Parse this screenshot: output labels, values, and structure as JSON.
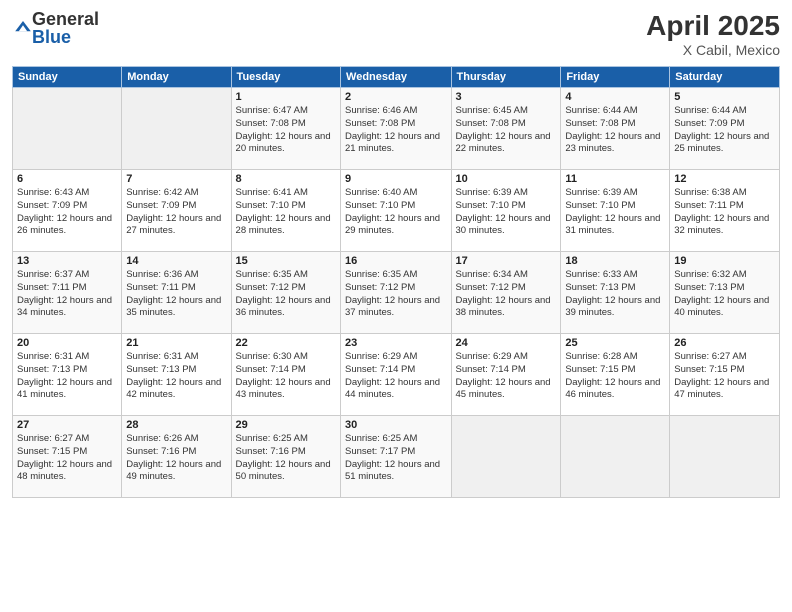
{
  "header": {
    "logo_general": "General",
    "logo_blue": "Blue",
    "title": "April 2025",
    "location": "X Cabil, Mexico"
  },
  "weekdays": [
    "Sunday",
    "Monday",
    "Tuesday",
    "Wednesday",
    "Thursday",
    "Friday",
    "Saturday"
  ],
  "weeks": [
    [
      {
        "day": "",
        "sunrise": "",
        "sunset": "",
        "daylight": ""
      },
      {
        "day": "",
        "sunrise": "",
        "sunset": "",
        "daylight": ""
      },
      {
        "day": "1",
        "sunrise": "Sunrise: 6:47 AM",
        "sunset": "Sunset: 7:08 PM",
        "daylight": "Daylight: 12 hours and 20 minutes."
      },
      {
        "day": "2",
        "sunrise": "Sunrise: 6:46 AM",
        "sunset": "Sunset: 7:08 PM",
        "daylight": "Daylight: 12 hours and 21 minutes."
      },
      {
        "day": "3",
        "sunrise": "Sunrise: 6:45 AM",
        "sunset": "Sunset: 7:08 PM",
        "daylight": "Daylight: 12 hours and 22 minutes."
      },
      {
        "day": "4",
        "sunrise": "Sunrise: 6:44 AM",
        "sunset": "Sunset: 7:08 PM",
        "daylight": "Daylight: 12 hours and 23 minutes."
      },
      {
        "day": "5",
        "sunrise": "Sunrise: 6:44 AM",
        "sunset": "Sunset: 7:09 PM",
        "daylight": "Daylight: 12 hours and 25 minutes."
      }
    ],
    [
      {
        "day": "6",
        "sunrise": "Sunrise: 6:43 AM",
        "sunset": "Sunset: 7:09 PM",
        "daylight": "Daylight: 12 hours and 26 minutes."
      },
      {
        "day": "7",
        "sunrise": "Sunrise: 6:42 AM",
        "sunset": "Sunset: 7:09 PM",
        "daylight": "Daylight: 12 hours and 27 minutes."
      },
      {
        "day": "8",
        "sunrise": "Sunrise: 6:41 AM",
        "sunset": "Sunset: 7:10 PM",
        "daylight": "Daylight: 12 hours and 28 minutes."
      },
      {
        "day": "9",
        "sunrise": "Sunrise: 6:40 AM",
        "sunset": "Sunset: 7:10 PM",
        "daylight": "Daylight: 12 hours and 29 minutes."
      },
      {
        "day": "10",
        "sunrise": "Sunrise: 6:39 AM",
        "sunset": "Sunset: 7:10 PM",
        "daylight": "Daylight: 12 hours and 30 minutes."
      },
      {
        "day": "11",
        "sunrise": "Sunrise: 6:39 AM",
        "sunset": "Sunset: 7:10 PM",
        "daylight": "Daylight: 12 hours and 31 minutes."
      },
      {
        "day": "12",
        "sunrise": "Sunrise: 6:38 AM",
        "sunset": "Sunset: 7:11 PM",
        "daylight": "Daylight: 12 hours and 32 minutes."
      }
    ],
    [
      {
        "day": "13",
        "sunrise": "Sunrise: 6:37 AM",
        "sunset": "Sunset: 7:11 PM",
        "daylight": "Daylight: 12 hours and 34 minutes."
      },
      {
        "day": "14",
        "sunrise": "Sunrise: 6:36 AM",
        "sunset": "Sunset: 7:11 PM",
        "daylight": "Daylight: 12 hours and 35 minutes."
      },
      {
        "day": "15",
        "sunrise": "Sunrise: 6:35 AM",
        "sunset": "Sunset: 7:12 PM",
        "daylight": "Daylight: 12 hours and 36 minutes."
      },
      {
        "day": "16",
        "sunrise": "Sunrise: 6:35 AM",
        "sunset": "Sunset: 7:12 PM",
        "daylight": "Daylight: 12 hours and 37 minutes."
      },
      {
        "day": "17",
        "sunrise": "Sunrise: 6:34 AM",
        "sunset": "Sunset: 7:12 PM",
        "daylight": "Daylight: 12 hours and 38 minutes."
      },
      {
        "day": "18",
        "sunrise": "Sunrise: 6:33 AM",
        "sunset": "Sunset: 7:13 PM",
        "daylight": "Daylight: 12 hours and 39 minutes."
      },
      {
        "day": "19",
        "sunrise": "Sunrise: 6:32 AM",
        "sunset": "Sunset: 7:13 PM",
        "daylight": "Daylight: 12 hours and 40 minutes."
      }
    ],
    [
      {
        "day": "20",
        "sunrise": "Sunrise: 6:31 AM",
        "sunset": "Sunset: 7:13 PM",
        "daylight": "Daylight: 12 hours and 41 minutes."
      },
      {
        "day": "21",
        "sunrise": "Sunrise: 6:31 AM",
        "sunset": "Sunset: 7:13 PM",
        "daylight": "Daylight: 12 hours and 42 minutes."
      },
      {
        "day": "22",
        "sunrise": "Sunrise: 6:30 AM",
        "sunset": "Sunset: 7:14 PM",
        "daylight": "Daylight: 12 hours and 43 minutes."
      },
      {
        "day": "23",
        "sunrise": "Sunrise: 6:29 AM",
        "sunset": "Sunset: 7:14 PM",
        "daylight": "Daylight: 12 hours and 44 minutes."
      },
      {
        "day": "24",
        "sunrise": "Sunrise: 6:29 AM",
        "sunset": "Sunset: 7:14 PM",
        "daylight": "Daylight: 12 hours and 45 minutes."
      },
      {
        "day": "25",
        "sunrise": "Sunrise: 6:28 AM",
        "sunset": "Sunset: 7:15 PM",
        "daylight": "Daylight: 12 hours and 46 minutes."
      },
      {
        "day": "26",
        "sunrise": "Sunrise: 6:27 AM",
        "sunset": "Sunset: 7:15 PM",
        "daylight": "Daylight: 12 hours and 47 minutes."
      }
    ],
    [
      {
        "day": "27",
        "sunrise": "Sunrise: 6:27 AM",
        "sunset": "Sunset: 7:15 PM",
        "daylight": "Daylight: 12 hours and 48 minutes."
      },
      {
        "day": "28",
        "sunrise": "Sunrise: 6:26 AM",
        "sunset": "Sunset: 7:16 PM",
        "daylight": "Daylight: 12 hours and 49 minutes."
      },
      {
        "day": "29",
        "sunrise": "Sunrise: 6:25 AM",
        "sunset": "Sunset: 7:16 PM",
        "daylight": "Daylight: 12 hours and 50 minutes."
      },
      {
        "day": "30",
        "sunrise": "Sunrise: 6:25 AM",
        "sunset": "Sunset: 7:17 PM",
        "daylight": "Daylight: 12 hours and 51 minutes."
      },
      {
        "day": "",
        "sunrise": "",
        "sunset": "",
        "daylight": ""
      },
      {
        "day": "",
        "sunrise": "",
        "sunset": "",
        "daylight": ""
      },
      {
        "day": "",
        "sunrise": "",
        "sunset": "",
        "daylight": ""
      }
    ]
  ]
}
